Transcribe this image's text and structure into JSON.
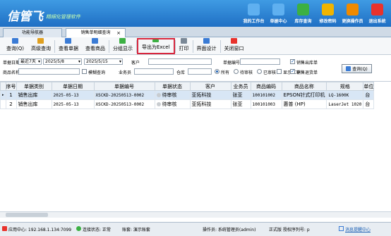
{
  "app": {
    "logo_mark": "信管飞",
    "name": "",
    "slogan": "精細化管理软件"
  },
  "topnav": [
    {
      "label": "我的工作台",
      "icon": "monitor-icon",
      "color": "#5fb0f0"
    },
    {
      "label": "单据中心",
      "icon": "list-icon",
      "color": "#5fb0f0"
    },
    {
      "label": "库存查询",
      "icon": "flag-icon",
      "color": "#3cb043"
    },
    {
      "label": "修改密码",
      "icon": "lock-icon",
      "color": "#f0b400"
    },
    {
      "label": "更换操作员",
      "icon": "user-icon",
      "color": "#f08a00"
    },
    {
      "label": "退出系统",
      "icon": "close-icon",
      "color": "#e8322c"
    }
  ],
  "tabs": [
    {
      "label": "功能导航器"
    },
    {
      "label": "销售单明细查询"
    }
  ],
  "toolbar": [
    {
      "label": "查询(Q)",
      "icon": "search-icon",
      "color": "#3a7bd5"
    },
    {
      "label": "高级查询",
      "icon": "advanced-search-icon",
      "color": "#e0a020"
    },
    {
      "label": "查看单据",
      "icon": "view-bill-icon",
      "color": "#3a7bd5"
    },
    {
      "label": "查看商品",
      "icon": "view-goods-icon",
      "color": "#3a7bd5"
    },
    {
      "label": "分组显示",
      "icon": "group-icon",
      "color": "#3cb043"
    },
    {
      "label": "导出为Excel",
      "icon": "excel-icon",
      "color": "#3cb043"
    },
    {
      "label": "打印",
      "icon": "print-icon",
      "color": "#7a8896"
    },
    {
      "label": "界面设计",
      "icon": "design-icon",
      "color": "#3a7bd5"
    },
    {
      "label": "关闭窗口",
      "icon": "close-window-icon",
      "color": "#e8322c"
    }
  ],
  "filter": {
    "date_label": "单据日期",
    "period": "最近7天",
    "from": "2025/5/8",
    "to": "2025/5/15",
    "customer_label": "客户",
    "customer": "",
    "billno_label": "单据编号",
    "billno": "",
    "goods_label": "商品名称",
    "goods": "",
    "fuzzy_label": "模糊查询",
    "clerk_label": "业务员",
    "clerk": "",
    "warehouse_label": "仓库",
    "warehouse": "",
    "radios": [
      "所有",
      "待审核",
      "已审核"
    ],
    "redwash_label": "显示红冲",
    "chk_out": "销售出库单",
    "chk_return": "销售退货单",
    "query_btn": "查询(Q)"
  },
  "table": {
    "headers": [
      "序号",
      "单据类别",
      "单据日期",
      "单据编号",
      "单据状态",
      "客户",
      "业务员",
      "商品编码",
      "商品名称",
      "规格",
      "单位"
    ],
    "rows": [
      [
        "1",
        "销售出库",
        "2025-05-13",
        "XSCKD-20250513-0002",
        "待审核",
        "亚拓科技",
        "张亚",
        "100101002",
        "EPSON针式打印机",
        "LQ-1600K",
        "台"
      ],
      [
        "2",
        "销售出库",
        "2025-05-13",
        "XSCKD-20250513-0002",
        "待审核",
        "亚拓科技",
        "张亚",
        "100101003",
        "惠普 (HP)",
        "LaserJet 1020",
        "台"
      ]
    ]
  },
  "status": {
    "server": "应用中心: 192.168.1.134:7099",
    "conn": "连接状态: 正常",
    "account": "账套: 演示账套",
    "operator": "操作员: 系统管理员(admin)",
    "version": "正式版 授权序列号: p",
    "msg": "消息提醒中心"
  }
}
